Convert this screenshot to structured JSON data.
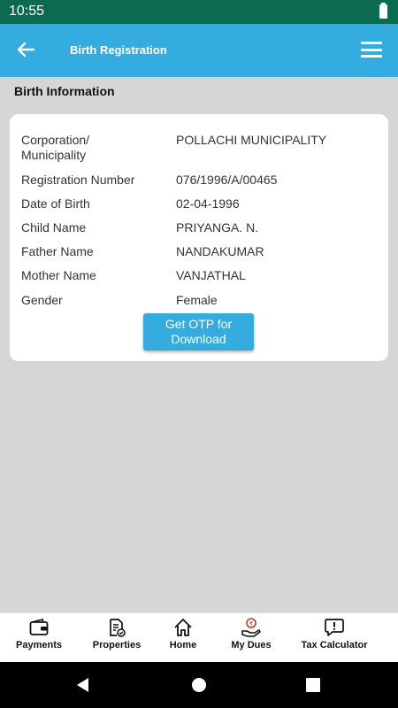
{
  "status_bar": {
    "time": "10:55"
  },
  "app_bar": {
    "title": "Birth Registration",
    "back_icon": "arrow-left-icon",
    "menu_icon": "hamburger-menu-icon"
  },
  "section": {
    "title": "Birth Information"
  },
  "details": [
    {
      "label": "Corporation/\nMunicipality",
      "value": "POLLACHI MUNICIPALITY"
    },
    {
      "label": "Registration Number",
      "value": "076/1996/A/00465"
    },
    {
      "label": "Date of Birth",
      "value": "02-04-1996"
    },
    {
      "label": "Child Name",
      "value": "PRIYANGA. N."
    },
    {
      "label": "Father Name",
      "value": "NANDAKUMAR"
    },
    {
      "label": "Mother Name",
      "value": "VANJATHAL"
    },
    {
      "label": "Gender",
      "value": "Female"
    }
  ],
  "otp_button": {
    "label": "Get OTP for Download"
  },
  "bottom_nav": [
    {
      "label": "Payments",
      "icon": "wallet-icon"
    },
    {
      "label": "Properties",
      "icon": "document-check-icon"
    },
    {
      "label": "Home",
      "icon": "home-icon"
    },
    {
      "label": "My Dues",
      "icon": "hand-rupee-icon"
    },
    {
      "label": "Tax Calculator",
      "icon": "alert-message-icon"
    }
  ],
  "colors": {
    "status_bar": "#0b6b50",
    "app_bar": "#34ace0",
    "background": "#d6d6d6",
    "card": "#ffffff",
    "button": "#34ace0"
  }
}
